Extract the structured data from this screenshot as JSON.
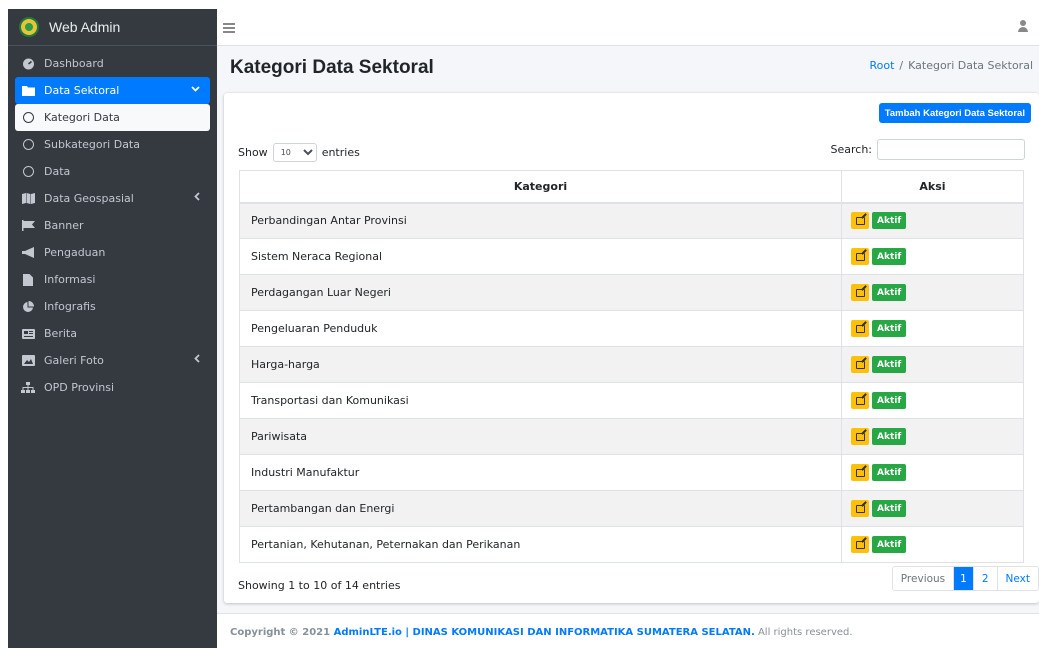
{
  "brand": {
    "title": "Web Admin"
  },
  "sidebar": {
    "items": [
      {
        "label": "Dashboard",
        "icon": "dashboard-icon"
      },
      {
        "label": "Data Sektoral",
        "icon": "folder-icon"
      },
      {
        "label": "Kategori Data",
        "icon": "circle-icon"
      },
      {
        "label": "Subkategori Data",
        "icon": "circle-icon"
      },
      {
        "label": "Data",
        "icon": "circle-icon"
      },
      {
        "label": "Data Geospasial",
        "icon": "map-icon"
      },
      {
        "label": "Banner",
        "icon": "flag-icon"
      },
      {
        "label": "Pengaduan",
        "icon": "bullhorn-icon"
      },
      {
        "label": "Informasi",
        "icon": "file-icon"
      },
      {
        "label": "Infografis",
        "icon": "pie-chart-icon"
      },
      {
        "label": "Berita",
        "icon": "newspaper-icon"
      },
      {
        "label": "Galeri Foto",
        "icon": "image-icon"
      },
      {
        "label": "OPD Provinsi",
        "icon": "sitemap-icon"
      }
    ]
  },
  "page": {
    "title": "Kategori Data Sektoral",
    "breadcrumb": {
      "root": "Root",
      "sep": "/",
      "current": "Kategori Data Sektoral"
    }
  },
  "toolbar": {
    "add_label": "Tambah Kategori Data Sektoral"
  },
  "table_controls": {
    "show": "Show",
    "entries": "entries",
    "length_value": "10",
    "search_label": "Search:",
    "search_value": ""
  },
  "table": {
    "headers": [
      "Kategori",
      "Aksi"
    ],
    "action_label": "Aktif",
    "rows": [
      "Perbandingan Antar Provinsi",
      "Sistem Neraca Regional",
      "Perdagangan Luar Negeri",
      "Pengeluaran Penduduk",
      "Harga-harga",
      "Transportasi dan Komunikasi",
      "Pariwisata",
      "Industri Manufaktur",
      "Pertambangan dan Energi",
      "Pertanian, Kehutanan, Peternakan dan Perikanan"
    ]
  },
  "pagination": {
    "info": "Showing 1 to 10 of 14 entries",
    "previous": "Previous",
    "pages": [
      "1",
      "2"
    ],
    "next": "Next"
  },
  "footer": {
    "prefix": "Copyright © 2021 ",
    "link": "AdminLTE.io | DINAS KOMUNIKASI DAN INFORMATIKA SUMATERA SELATAN.",
    "suffix": " All rights reserved."
  },
  "colors": {
    "primary": "#007bff",
    "sidebar": "#343a40",
    "warning": "#ffc107",
    "success": "#28a745"
  }
}
